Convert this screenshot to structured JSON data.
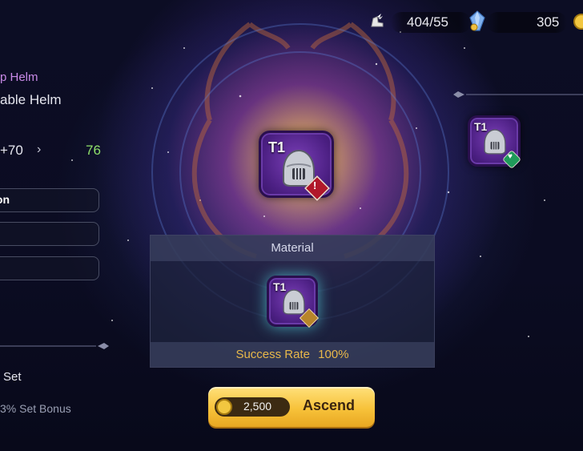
{
  "left_panel": {
    "item_type": "p Helm",
    "item_name": "able Helm",
    "level_from": "+70",
    "level_to": "76",
    "stat_rows": [
      "ion",
      "",
      ""
    ],
    "set_label": "Set",
    "set_bonus": "3% Set Bonus"
  },
  "top_bar": {
    "stamina": "404/55",
    "crystals": "305"
  },
  "center_item": {
    "tier": "T1",
    "badge_color": "#b0182a"
  },
  "right_item": {
    "tier": "T1",
    "badge_color": "#1f9a5a"
  },
  "material": {
    "header": "Material",
    "tier": "T1",
    "success_label": "Success Rate",
    "success_value": "100%"
  },
  "ascend_button": {
    "cost": "2,500",
    "label": "Ascend"
  },
  "colors": {
    "accent_gold": "#e8b84a",
    "level_green": "#8fe06a",
    "item_type_purple": "#c98ae8"
  }
}
